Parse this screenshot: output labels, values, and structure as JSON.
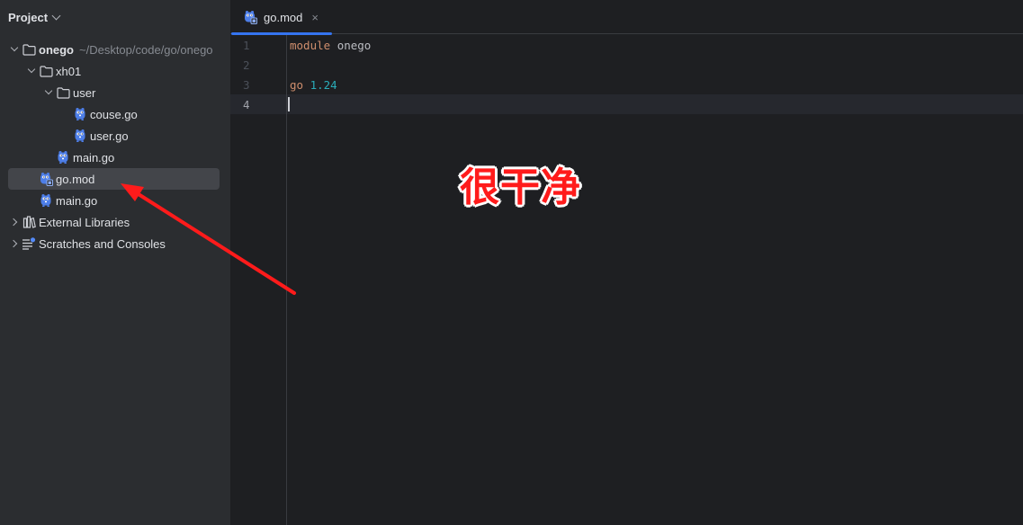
{
  "project_panel": {
    "title": "Project"
  },
  "tree": [
    {
      "id": "onego",
      "name": "onego",
      "path": "~/Desktop/code/go/onego",
      "type": "folder",
      "expanded": true,
      "indent": 0,
      "bold": true
    },
    {
      "id": "xh01",
      "name": "xh01",
      "type": "folder",
      "expanded": true,
      "indent": 1
    },
    {
      "id": "user",
      "name": "user",
      "type": "folder",
      "expanded": true,
      "indent": 2
    },
    {
      "id": "couse-go",
      "name": "couse.go",
      "type": "go-file",
      "indent": 3
    },
    {
      "id": "user-go",
      "name": "user.go",
      "type": "go-file",
      "indent": 3
    },
    {
      "id": "xh01-main-go",
      "name": "main.go",
      "type": "go-file",
      "indent": 2
    },
    {
      "id": "go-mod",
      "name": "go.mod",
      "type": "gomod-file",
      "indent": 1,
      "selected": true
    },
    {
      "id": "main-go",
      "name": "main.go",
      "type": "go-file",
      "indent": 1
    },
    {
      "id": "external-libraries",
      "name": "External Libraries",
      "type": "library",
      "expanded": false,
      "indent": 0
    },
    {
      "id": "scratches",
      "name": "Scratches and Consoles",
      "type": "scratches",
      "expanded": false,
      "indent": 0
    }
  ],
  "editor": {
    "tab": {
      "label": "go.mod",
      "close": "×"
    },
    "lines": [
      {
        "number": "1",
        "tokens": [
          {
            "text": "module",
            "kind": "kw"
          },
          {
            "text": " ",
            "kind": "sp"
          },
          {
            "text": "onego",
            "kind": "id"
          }
        ]
      },
      {
        "number": "2",
        "tokens": []
      },
      {
        "number": "3",
        "tokens": [
          {
            "text": "go",
            "kind": "kw"
          },
          {
            "text": " ",
            "kind": "sp"
          },
          {
            "text": "1.24",
            "kind": "num"
          }
        ]
      },
      {
        "number": "4",
        "tokens": [],
        "current": true
      }
    ]
  },
  "annotation": {
    "text": "很干净",
    "color": "#ff1b1b"
  },
  "colors": {
    "accent": "#3574f0",
    "sidebar_bg": "#2b2d30",
    "editor_bg": "#1e1f22",
    "selection_bg": "#43454a",
    "keyword": "#cf8e6d",
    "number": "#2aacb8"
  }
}
